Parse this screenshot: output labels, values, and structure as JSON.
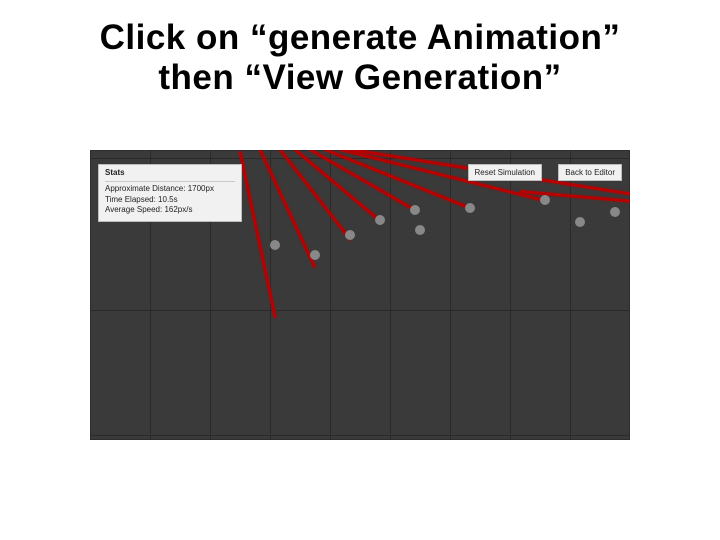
{
  "title_line1": "Click on “generate Animation”",
  "title_line2": "then “View Generation”",
  "stats": {
    "header": "Stats",
    "line1": "Approximate Distance: 1700px",
    "line2": "Time Elapsed: 10.5s",
    "line3": "Average Speed: 162px/s"
  },
  "buttons": {
    "reset": "Reset Simulation",
    "back": "Back to Editor"
  }
}
